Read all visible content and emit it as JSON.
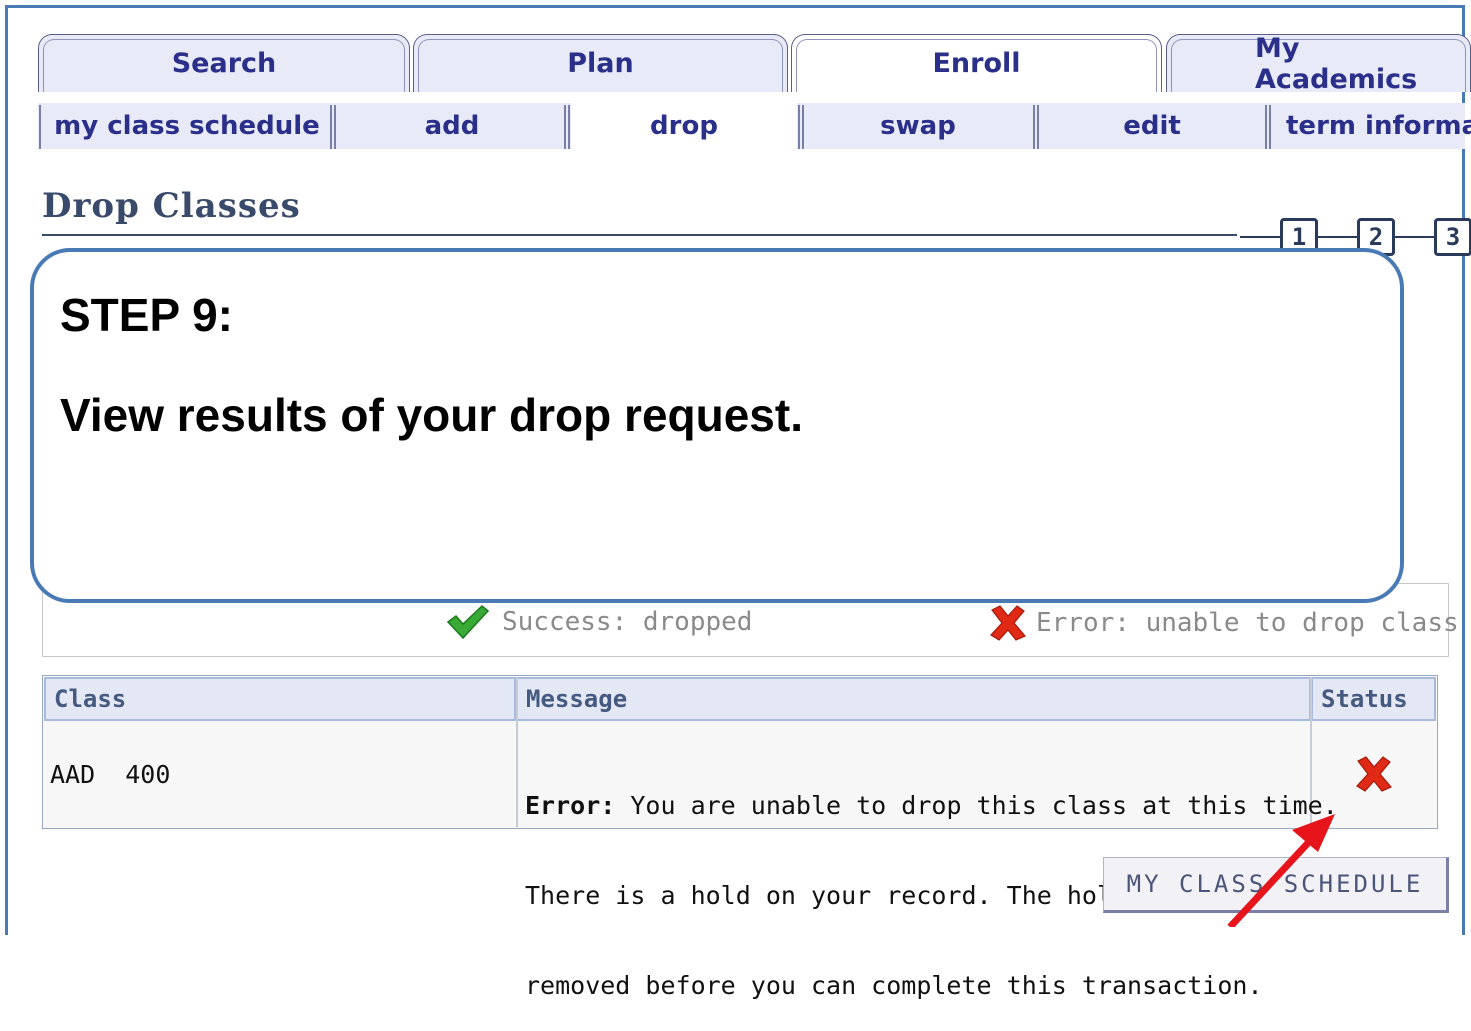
{
  "main_tabs": [
    {
      "label": "Search",
      "active": false
    },
    {
      "label": "Plan",
      "active": false
    },
    {
      "label": "Enroll",
      "active": true
    },
    {
      "label": "My Academics",
      "active": false
    }
  ],
  "sub_tabs": [
    {
      "label": "my class schedule",
      "active": false
    },
    {
      "label": "add",
      "active": false
    },
    {
      "label": "drop",
      "active": true
    },
    {
      "label": "swap",
      "active": false
    },
    {
      "label": "edit",
      "active": false
    },
    {
      "label": "term informa",
      "active": false
    }
  ],
  "page_title": "Drop Classes",
  "steps": [
    "1",
    "2",
    "3"
  ],
  "callout": {
    "step": "STEP 9:",
    "text": "View results of your drop request."
  },
  "legend": {
    "success": "Success: dropped",
    "error": "Error: unable to drop class"
  },
  "results_table": {
    "headers": [
      "Class",
      "Message",
      "Status"
    ],
    "rows": [
      {
        "class": "AAD  400",
        "message_label": "Error:",
        "message_line1": " You are unable to drop this class at this time.",
        "message_line2": "There is a hold on your record. The hold must be",
        "message_line3": "removed before you can complete this transaction.",
        "status_icon": "error-x-icon"
      }
    ]
  },
  "buttons": {
    "my_class_schedule": "MY CLASS SCHEDULE"
  },
  "colors": {
    "tab_text": "#2a2f8a",
    "tab_bg": "#e9eaf8",
    "frame_border": "#4a7ab5",
    "success_green": "#39a935",
    "error_red": "#e02a16",
    "arrow_red": "#e8141b"
  }
}
